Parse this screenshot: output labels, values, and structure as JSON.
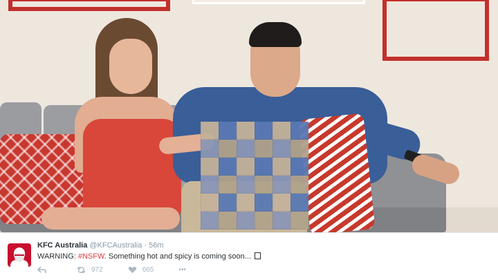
{
  "tweet": {
    "author_name": "KFC Australia",
    "handle": "@KFCAustralia",
    "separator": "·",
    "time": "56m",
    "text_prefix": "WARNING:",
    "hashtag": "#NSFW",
    "text_suffix": ". Something hot and spicy is coming soon...",
    "retweet_count": "972",
    "like_count": "665",
    "more_label": "•••"
  },
  "colors": {
    "accent": "#e2393b",
    "brand": "#c8102e",
    "muted": "#8899a6",
    "text": "#292f33"
  },
  "icons": [
    "reply-icon",
    "retweet-icon",
    "like-icon",
    "more-icon"
  ]
}
